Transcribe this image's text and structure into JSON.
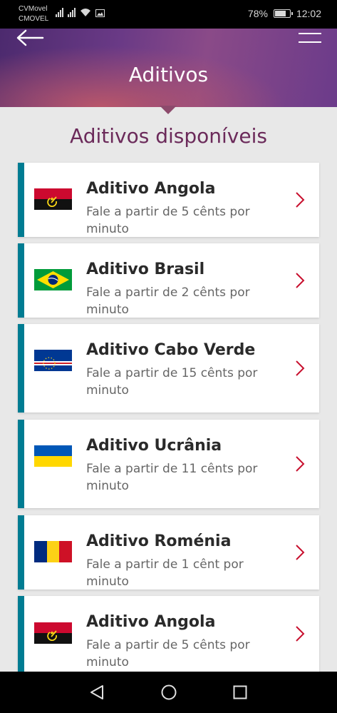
{
  "status_bar": {
    "carrier_1": "CVMovel",
    "carrier_2": "CMOVEL",
    "battery": "78%",
    "time": "12:02",
    "battery_level": 0.78
  },
  "header": {
    "title": "Aditivos",
    "back_icon": "back-arrow-icon",
    "menu_icon": "hamburger-menu-icon"
  },
  "section_title": "Aditivos disponíveis",
  "addons": [
    {
      "title": "Aditivo Angola",
      "subtitle": "Fale a partir de 5 cênts por minuto",
      "flag": "angola"
    },
    {
      "title": "Aditivo Brasil",
      "subtitle": "Fale a partir de 2 cênts por minuto",
      "flag": "brasil"
    },
    {
      "title": "Aditivo Cabo Verde",
      "subtitle": "Fale a partir de 15 cênts por minuto",
      "flag": "cabo-verde"
    },
    {
      "title": "Aditivo Ucrânia",
      "subtitle": "Fale a partir de 11 cênts por minuto",
      "flag": "ucrania"
    },
    {
      "title": "Aditivo Roménia",
      "subtitle": "Fale a partir de 1 cênt por minuto",
      "flag": "romenia"
    },
    {
      "title": "Aditivo Angola",
      "subtitle": "Fale a partir de 5 cênts por minuto",
      "flag": "angola"
    }
  ],
  "colors": {
    "accent_bar": "#007c92",
    "section_title": "#6b2a5a",
    "chevron": "#c8102e"
  },
  "nav_bar": [
    "back-triangle-icon",
    "home-circle-icon",
    "recents-square-icon"
  ]
}
